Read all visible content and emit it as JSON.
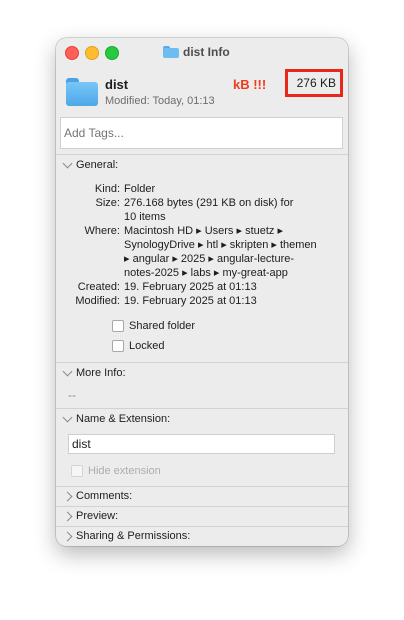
{
  "window": {
    "title": "dist Info"
  },
  "header": {
    "name": "dist",
    "modified": "Modified: Today, 01:13",
    "annotation": "kB !!!",
    "size": "276 KB",
    "tags_placeholder": "Add Tags..."
  },
  "general": {
    "heading": "General:",
    "kind_label": "Kind:",
    "kind_value": "Folder",
    "size_label": "Size:",
    "size_value_1": "276.168 bytes (291 KB on disk) for",
    "size_value_2": "10 items",
    "where_label": "Where:",
    "where_line_1": "Macintosh HD ▸ Users ▸ stuetz ▸",
    "where_line_2": "SynologyDrive ▸ htl ▸ skripten ▸ themen",
    "where_line_3": "▸ angular ▸ 2025 ▸ angular-lecture-",
    "where_line_4": "notes-2025 ▸ labs ▸ my-great-app",
    "created_label": "Created:",
    "created_value": "19. February 2025 at 01:13",
    "modified_label": "Modified:",
    "modified_value": "19. February 2025 at 01:13",
    "shared_folder_label": "Shared folder",
    "locked_label": "Locked"
  },
  "more_info": {
    "heading": "More Info:",
    "value": "--"
  },
  "name_extension": {
    "heading": "Name & Extension:",
    "value": "dist",
    "hide_extension_label": "Hide extension"
  },
  "collapsed_sections": {
    "comments": "Comments:",
    "preview": "Preview:",
    "sharing": "Sharing & Permissions:"
  },
  "colors": {
    "annotation": "#f03c1c",
    "highlight_box": "#e8261a",
    "folder": "#5aa9e6"
  }
}
